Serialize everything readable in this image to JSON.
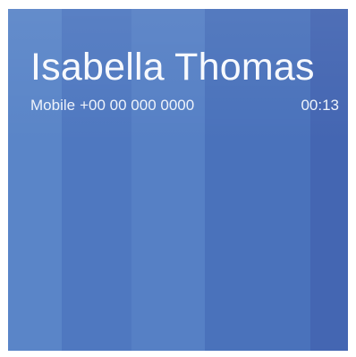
{
  "call": {
    "caller_name": "Isabella Thomas",
    "number_type": "Mobile",
    "phone_number": "+00 00 000 0000",
    "elapsed_time": "00:13"
  },
  "colors": {
    "background": "#4c74bc",
    "text": "#f7f9fd"
  }
}
